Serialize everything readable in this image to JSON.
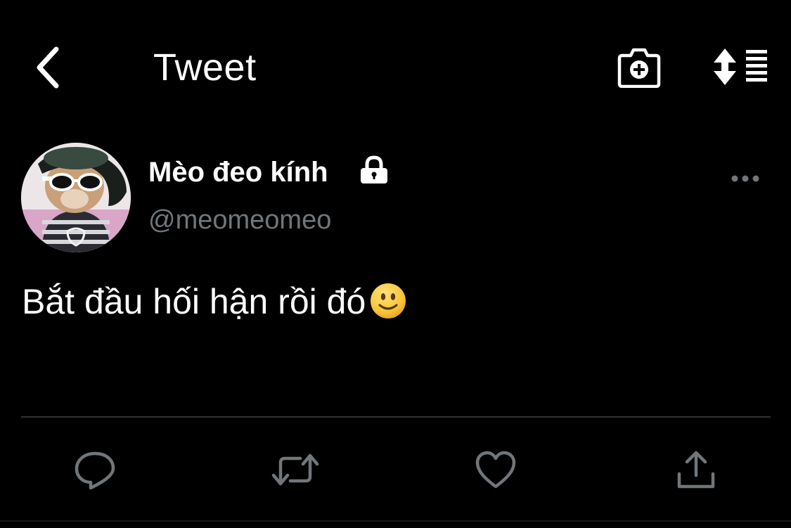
{
  "header": {
    "title": "Tweet"
  },
  "author": {
    "display_name": "Mèo đeo kính",
    "handle": "@meomeomeo",
    "protected": true
  },
  "tweet": {
    "text": "Bắt đầu hối hận rồi đó"
  },
  "icons": {
    "back": "chevron-left-icon",
    "camera": "camera-add-icon",
    "sort": "sort-list-icon",
    "lock": "lock-icon",
    "more": "more-horizontal-icon",
    "emoji": "slightly-smiling-face-emoji",
    "reply": "reply-icon",
    "retweet": "retweet-icon",
    "like": "heart-icon",
    "share": "share-icon"
  },
  "colors": {
    "background": "#000000",
    "text_primary": "#ffffff",
    "text_secondary": "#71767b",
    "divider": "#2f3336"
  }
}
